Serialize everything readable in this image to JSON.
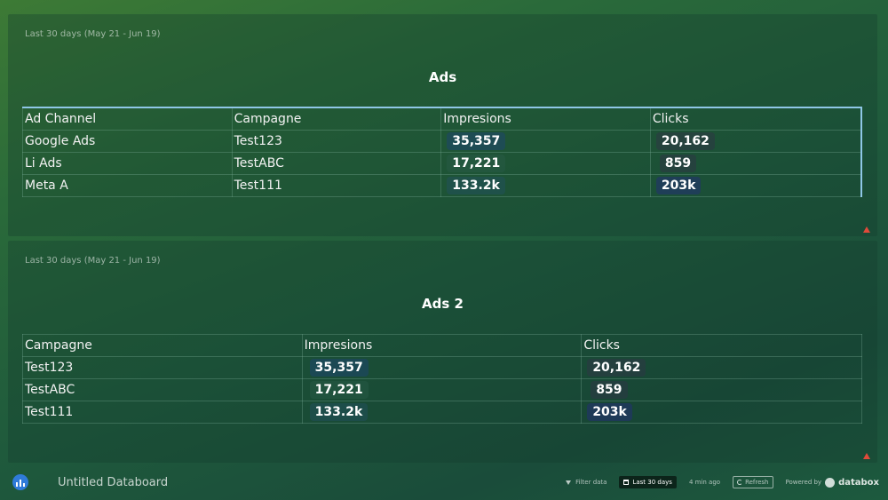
{
  "panels": [
    {
      "date_range": "Last 30 days (May 21 - Jun 19)",
      "title": "Ads",
      "columns": [
        "Ad Channel",
        "Campagne",
        "Impresions",
        "Clicks"
      ],
      "rows": [
        {
          "channel": "Google Ads",
          "campaign": "Test123",
          "impressions": "35,357",
          "clicks": "20,162"
        },
        {
          "channel": "Li Ads",
          "campaign": "TestABC",
          "impressions": "17,221",
          "clicks": "859"
        },
        {
          "channel": "Meta A",
          "campaign": "Test111",
          "impressions": "133.2k",
          "clicks": "203k"
        }
      ]
    },
    {
      "date_range": "Last 30 days (May 21 - Jun 19)",
      "title": "Ads 2",
      "columns": [
        "Campagne",
        "Impresions",
        "Clicks"
      ],
      "rows": [
        {
          "campaign": "Test123",
          "impressions": "35,357",
          "clicks": "20,162"
        },
        {
          "campaign": "TestABC",
          "impressions": "17,221",
          "clicks": "859"
        },
        {
          "campaign": "Test111",
          "impressions": "133.2k",
          "clicks": "203k"
        }
      ]
    }
  ],
  "footer": {
    "board_name": "Untitled Databoard",
    "filter_label": "Filter data",
    "range_label": "Last 30 days",
    "updated": "4 min ago",
    "refresh_label": "Refresh",
    "powered_by": "Powered by",
    "brand": "databox"
  },
  "colors": {
    "accent": "#8fc7e6",
    "warning": "#e04a3a",
    "logo": "#2f7bd9"
  },
  "icons": [
    "databox-logo-icon",
    "warning-icon",
    "filter-icon",
    "calendar-icon",
    "refresh-icon"
  ]
}
